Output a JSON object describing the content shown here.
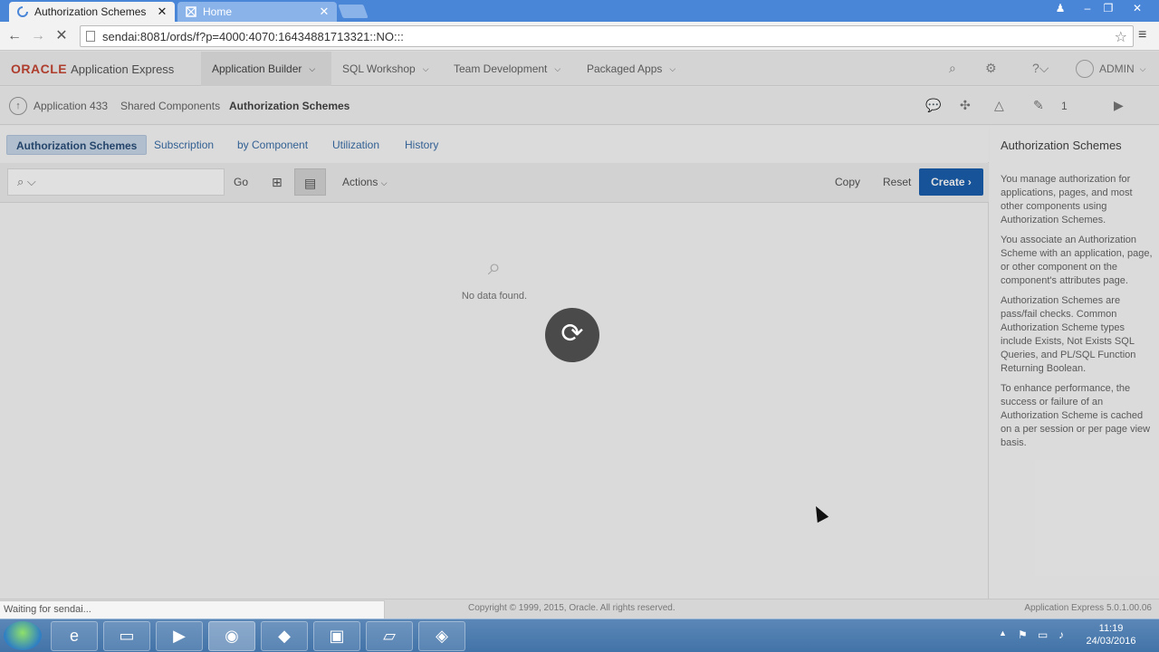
{
  "browser": {
    "tabs": [
      {
        "label": "Authorization Schemes",
        "close": "✕"
      },
      {
        "label": "Home",
        "close": "✕"
      }
    ],
    "url": "sendai:8081/ords/f?p=4000:4070:16434881713321::NO:::",
    "status_text": "Waiting for sendai..."
  },
  "apex": {
    "logo": "ORACLE",
    "product": "Application Express",
    "nav": [
      {
        "label": "Application Builder"
      },
      {
        "label": "SQL Workshop"
      },
      {
        "label": "Team Development"
      },
      {
        "label": "Packaged Apps"
      }
    ],
    "user": "ADMIN",
    "breadcrumb": [
      "Application 433",
      "Shared Components",
      "Authorization Schemes"
    ],
    "dev_count": "1",
    "subtabs": [
      "Authorization Schemes",
      "Subscription",
      "by Component",
      "Utilization",
      "History"
    ],
    "toolbar": {
      "go": "Go",
      "actions": "Actions",
      "copy": "Copy",
      "reset": "Reset",
      "create": "Create"
    },
    "no_data": "No data found.",
    "help": {
      "title": "Authorization Schemes",
      "paragraphs": [
        "You manage authorization for applications, pages, and most other components using Authorization Schemes.",
        "You associate an Authorization Scheme with an application, page, or other component on the component's attributes page.",
        "Authorization Schemes are pass/fail checks. Common Authorization Scheme types include Exists, Not Exists SQL Queries, and PL/SQL Function Returning Boolean.",
        "To enhance performance, the success or failure of an Authorization Scheme is cached on a per session or per page view basis."
      ]
    },
    "footer": {
      "copyright": "Copyright © 1999, 2015, Oracle. All rights reserved.",
      "version": "Application Express 5.0.1.00.06"
    }
  },
  "taskbar": {
    "time": "11:19",
    "date": "24/03/2016"
  },
  "colors": {
    "oracle_red": "#c74634",
    "create_button": "#1a5faf",
    "link_blue": "#3a6ea8",
    "chrome_tabbar": "#4a86d8"
  }
}
